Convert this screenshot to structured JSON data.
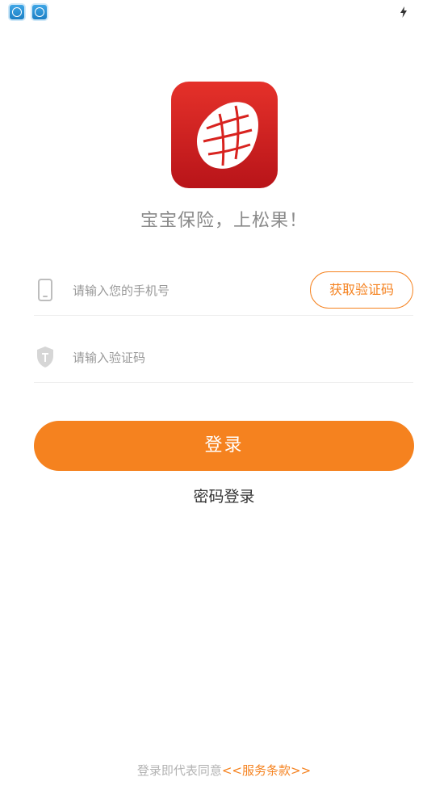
{
  "brand": {
    "slogan": "宝宝保险，上松果！",
    "accent_color": "#f5821f",
    "logo_color": "#d8231f"
  },
  "status_bar": {
    "icons": [
      "app-icon",
      "app-icon",
      "charging-icon"
    ]
  },
  "form": {
    "phone": {
      "placeholder": "请输入您的手机号",
      "icon": "phone-icon"
    },
    "get_code_label": "获取验证码",
    "code": {
      "placeholder": "请输入验证码",
      "icon": "shield-icon"
    }
  },
  "actions": {
    "login_label": "登录",
    "password_login_label": "密码登录"
  },
  "footer": {
    "agreement_prefix": "登录即代表同意",
    "terms_link": "<<服务条款>>"
  }
}
